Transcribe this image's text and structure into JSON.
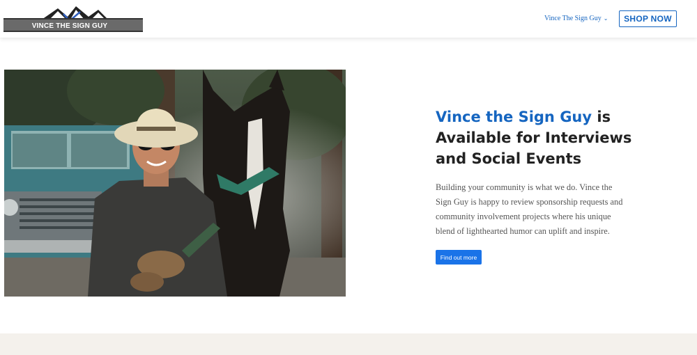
{
  "header": {
    "logo_text": "VINCE THE SIGN GUY",
    "nav_label": "Vince The Sign Guy",
    "nav_icon": "chevron-down-icon",
    "shop_label": "SHOP NOW"
  },
  "hero": {
    "image_alt": "Man in cowboy hat and sunglasses standing with a dark horse in front of a teal pickup truck",
    "headline_accent": "Vince the Sign Guy",
    "headline_rest": " is Available for Interviews and Social Events",
    "body": "Building your community is what we do. Vince the Sign Guy is happy to review sponsorship requests and community involvement projects where his unique blend of lighthearted humor can uplift and inspire.",
    "cta_label": "Find out more"
  },
  "colors": {
    "accent": "#1565c0",
    "button": "#1a73e8",
    "heading": "#222222",
    "body_text": "#555555",
    "band": "#f4f1ec"
  }
}
